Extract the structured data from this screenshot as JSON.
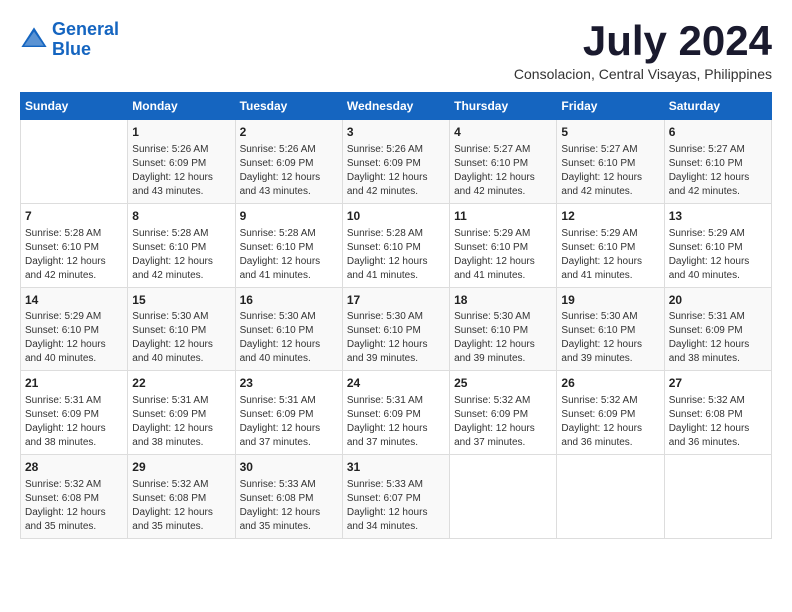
{
  "header": {
    "logo_line1": "General",
    "logo_line2": "Blue",
    "month_year": "July 2024",
    "location": "Consolacion, Central Visayas, Philippines"
  },
  "weekdays": [
    "Sunday",
    "Monday",
    "Tuesday",
    "Wednesday",
    "Thursday",
    "Friday",
    "Saturday"
  ],
  "weeks": [
    [
      {
        "day": "",
        "sunrise": "",
        "sunset": "",
        "daylight": ""
      },
      {
        "day": "1",
        "sunrise": "Sunrise: 5:26 AM",
        "sunset": "Sunset: 6:09 PM",
        "daylight": "Daylight: 12 hours and 43 minutes."
      },
      {
        "day": "2",
        "sunrise": "Sunrise: 5:26 AM",
        "sunset": "Sunset: 6:09 PM",
        "daylight": "Daylight: 12 hours and 43 minutes."
      },
      {
        "day": "3",
        "sunrise": "Sunrise: 5:26 AM",
        "sunset": "Sunset: 6:09 PM",
        "daylight": "Daylight: 12 hours and 42 minutes."
      },
      {
        "day": "4",
        "sunrise": "Sunrise: 5:27 AM",
        "sunset": "Sunset: 6:10 PM",
        "daylight": "Daylight: 12 hours and 42 minutes."
      },
      {
        "day": "5",
        "sunrise": "Sunrise: 5:27 AM",
        "sunset": "Sunset: 6:10 PM",
        "daylight": "Daylight: 12 hours and 42 minutes."
      },
      {
        "day": "6",
        "sunrise": "Sunrise: 5:27 AM",
        "sunset": "Sunset: 6:10 PM",
        "daylight": "Daylight: 12 hours and 42 minutes."
      }
    ],
    [
      {
        "day": "7",
        "sunrise": "Sunrise: 5:28 AM",
        "sunset": "Sunset: 6:10 PM",
        "daylight": "Daylight: 12 hours and 42 minutes."
      },
      {
        "day": "8",
        "sunrise": "Sunrise: 5:28 AM",
        "sunset": "Sunset: 6:10 PM",
        "daylight": "Daylight: 12 hours and 42 minutes."
      },
      {
        "day": "9",
        "sunrise": "Sunrise: 5:28 AM",
        "sunset": "Sunset: 6:10 PM",
        "daylight": "Daylight: 12 hours and 41 minutes."
      },
      {
        "day": "10",
        "sunrise": "Sunrise: 5:28 AM",
        "sunset": "Sunset: 6:10 PM",
        "daylight": "Daylight: 12 hours and 41 minutes."
      },
      {
        "day": "11",
        "sunrise": "Sunrise: 5:29 AM",
        "sunset": "Sunset: 6:10 PM",
        "daylight": "Daylight: 12 hours and 41 minutes."
      },
      {
        "day": "12",
        "sunrise": "Sunrise: 5:29 AM",
        "sunset": "Sunset: 6:10 PM",
        "daylight": "Daylight: 12 hours and 41 minutes."
      },
      {
        "day": "13",
        "sunrise": "Sunrise: 5:29 AM",
        "sunset": "Sunset: 6:10 PM",
        "daylight": "Daylight: 12 hours and 40 minutes."
      }
    ],
    [
      {
        "day": "14",
        "sunrise": "Sunrise: 5:29 AM",
        "sunset": "Sunset: 6:10 PM",
        "daylight": "Daylight: 12 hours and 40 minutes."
      },
      {
        "day": "15",
        "sunrise": "Sunrise: 5:30 AM",
        "sunset": "Sunset: 6:10 PM",
        "daylight": "Daylight: 12 hours and 40 minutes."
      },
      {
        "day": "16",
        "sunrise": "Sunrise: 5:30 AM",
        "sunset": "Sunset: 6:10 PM",
        "daylight": "Daylight: 12 hours and 40 minutes."
      },
      {
        "day": "17",
        "sunrise": "Sunrise: 5:30 AM",
        "sunset": "Sunset: 6:10 PM",
        "daylight": "Daylight: 12 hours and 39 minutes."
      },
      {
        "day": "18",
        "sunrise": "Sunrise: 5:30 AM",
        "sunset": "Sunset: 6:10 PM",
        "daylight": "Daylight: 12 hours and 39 minutes."
      },
      {
        "day": "19",
        "sunrise": "Sunrise: 5:30 AM",
        "sunset": "Sunset: 6:10 PM",
        "daylight": "Daylight: 12 hours and 39 minutes."
      },
      {
        "day": "20",
        "sunrise": "Sunrise: 5:31 AM",
        "sunset": "Sunset: 6:09 PM",
        "daylight": "Daylight: 12 hours and 38 minutes."
      }
    ],
    [
      {
        "day": "21",
        "sunrise": "Sunrise: 5:31 AM",
        "sunset": "Sunset: 6:09 PM",
        "daylight": "Daylight: 12 hours and 38 minutes."
      },
      {
        "day": "22",
        "sunrise": "Sunrise: 5:31 AM",
        "sunset": "Sunset: 6:09 PM",
        "daylight": "Daylight: 12 hours and 38 minutes."
      },
      {
        "day": "23",
        "sunrise": "Sunrise: 5:31 AM",
        "sunset": "Sunset: 6:09 PM",
        "daylight": "Daylight: 12 hours and 37 minutes."
      },
      {
        "day": "24",
        "sunrise": "Sunrise: 5:31 AM",
        "sunset": "Sunset: 6:09 PM",
        "daylight": "Daylight: 12 hours and 37 minutes."
      },
      {
        "day": "25",
        "sunrise": "Sunrise: 5:32 AM",
        "sunset": "Sunset: 6:09 PM",
        "daylight": "Daylight: 12 hours and 37 minutes."
      },
      {
        "day": "26",
        "sunrise": "Sunrise: 5:32 AM",
        "sunset": "Sunset: 6:09 PM",
        "daylight": "Daylight: 12 hours and 36 minutes."
      },
      {
        "day": "27",
        "sunrise": "Sunrise: 5:32 AM",
        "sunset": "Sunset: 6:08 PM",
        "daylight": "Daylight: 12 hours and 36 minutes."
      }
    ],
    [
      {
        "day": "28",
        "sunrise": "Sunrise: 5:32 AM",
        "sunset": "Sunset: 6:08 PM",
        "daylight": "Daylight: 12 hours and 35 minutes."
      },
      {
        "day": "29",
        "sunrise": "Sunrise: 5:32 AM",
        "sunset": "Sunset: 6:08 PM",
        "daylight": "Daylight: 12 hours and 35 minutes."
      },
      {
        "day": "30",
        "sunrise": "Sunrise: 5:33 AM",
        "sunset": "Sunset: 6:08 PM",
        "daylight": "Daylight: 12 hours and 35 minutes."
      },
      {
        "day": "31",
        "sunrise": "Sunrise: 5:33 AM",
        "sunset": "Sunset: 6:07 PM",
        "daylight": "Daylight: 12 hours and 34 minutes."
      },
      {
        "day": "",
        "sunrise": "",
        "sunset": "",
        "daylight": ""
      },
      {
        "day": "",
        "sunrise": "",
        "sunset": "",
        "daylight": ""
      },
      {
        "day": "",
        "sunrise": "",
        "sunset": "",
        "daylight": ""
      }
    ]
  ]
}
